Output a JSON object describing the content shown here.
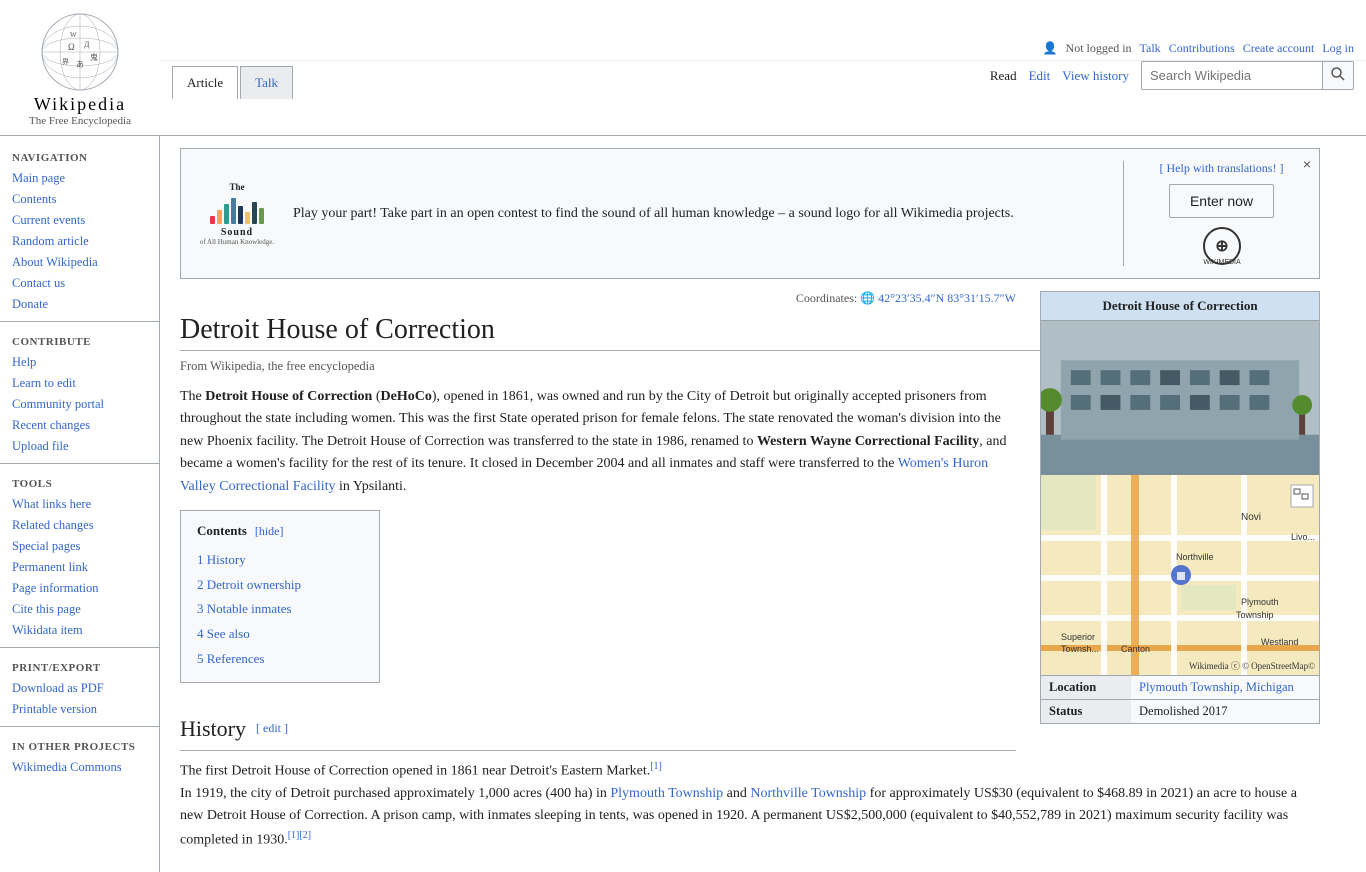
{
  "topbar": {
    "not_logged_in": "Not logged in",
    "talk": "Talk",
    "contributions": "Contributions",
    "create_account": "Create account",
    "log_in": "Log in"
  },
  "logo": {
    "title": "Wikipedia",
    "subtitle": "The Free Encyclopedia"
  },
  "tabs": {
    "article": "Article",
    "talk": "Talk",
    "read": "Read",
    "edit": "Edit",
    "view_history": "View history"
  },
  "search": {
    "placeholder": "Search Wikipedia"
  },
  "sidebar": {
    "navigation_title": "Navigation",
    "items": [
      {
        "label": "Main page",
        "id": "main-page"
      },
      {
        "label": "Contents",
        "id": "contents"
      },
      {
        "label": "Current events",
        "id": "current-events"
      },
      {
        "label": "Random article",
        "id": "random-article"
      },
      {
        "label": "About Wikipedia",
        "id": "about-wikipedia"
      },
      {
        "label": "Contact us",
        "id": "contact-us"
      },
      {
        "label": "Donate",
        "id": "donate"
      }
    ],
    "contribute_title": "Contribute",
    "contribute_items": [
      {
        "label": "Help",
        "id": "help"
      },
      {
        "label": "Learn to edit",
        "id": "learn-to-edit"
      },
      {
        "label": "Community portal",
        "id": "community-portal"
      },
      {
        "label": "Recent changes",
        "id": "recent-changes"
      },
      {
        "label": "Upload file",
        "id": "upload-file"
      }
    ],
    "tools_title": "Tools",
    "tools_items": [
      {
        "label": "What links here",
        "id": "what-links-here"
      },
      {
        "label": "Related changes",
        "id": "related-changes"
      },
      {
        "label": "Special pages",
        "id": "special-pages"
      },
      {
        "label": "Permanent link",
        "id": "permanent-link"
      },
      {
        "label": "Page information",
        "id": "page-information"
      },
      {
        "label": "Cite this page",
        "id": "cite-this-page"
      },
      {
        "label": "Wikidata item",
        "id": "wikidata-item"
      }
    ],
    "print_title": "Print/export",
    "print_items": [
      {
        "label": "Download as PDF",
        "id": "download-pdf"
      },
      {
        "label": "Printable version",
        "id": "printable-version"
      }
    ],
    "other_title": "In other projects",
    "other_items": [
      {
        "label": "Wikimedia Commons",
        "id": "wikimedia-commons"
      }
    ]
  },
  "banner": {
    "help_text": "[ Help with translations! ]",
    "logo_text": "The Sound of All Human Knowledge.",
    "main_text": "Play your part! Take part in an open contest to find the sound of all human knowledge – a sound logo for all Wikimedia projects.",
    "enter_now": "Enter now",
    "close_label": "×"
  },
  "article": {
    "title": "Detroit House of Correction",
    "from_wikipedia": "From Wikipedia, the free encyclopedia",
    "coordinates_label": "Coordinates:",
    "coordinates_value": "42°23′35.4″N 83°31′15.7″W",
    "intro": "The Detroit House of Correction (DeHoCo), opened in 1861, was owned and run by the City of Detroit but originally accepted prisoners from throughout the state including women. This was the first State operated prison for female felons. The state renovated the woman's division into the new Phoenix facility. The Detroit House of Correction was transferred to the state in 1986, renamed to Western Wayne Correctional Facility, and became a women's facility for the rest of its tenure. It closed in December 2004 and all inmates and staff were transferred to the Women's Huron Valley Correctional Facility in Ypsilanti.",
    "toc_title": "Contents",
    "toc_hide": "[hide]",
    "toc_items": [
      {
        "num": "1",
        "label": "History"
      },
      {
        "num": "2",
        "label": "Detroit ownership"
      },
      {
        "num": "3",
        "label": "Notable inmates"
      },
      {
        "num": "4",
        "label": "See also"
      },
      {
        "num": "5",
        "label": "References"
      }
    ],
    "history_heading": "History",
    "history_edit": "[ edit ]",
    "history_p1": "The first Detroit House of Correction opened in 1861 near Detroit's Eastern Market.",
    "history_p1_ref": "[1]",
    "history_p2": "In 1919, the city of Detroit purchased approximately 1,000 acres (400 ha) in Plymouth Township and Northville Township for approximately US$30 (equivalent to $468.89 in 2021) an acre to house a new Detroit House of Correction. A prison camp, with inmates sleeping in tents, was opened in 1920. A permanent US$2,500,000 (equivalent to $40,552,789 in 2021) maximum security facility was completed in 1930.",
    "history_p2_ref1": "[1]",
    "history_p2_ref2": "[2]",
    "infobox_title": "Detroit House of Correction",
    "infobox_location_label": "Location",
    "infobox_location_value": "Plymouth Township, Michigan",
    "infobox_status_label": "Status",
    "infobox_status_value": "Demolished 2017",
    "map_attribution": "Wikimedia ⓒ © OpenStreetMap©"
  }
}
